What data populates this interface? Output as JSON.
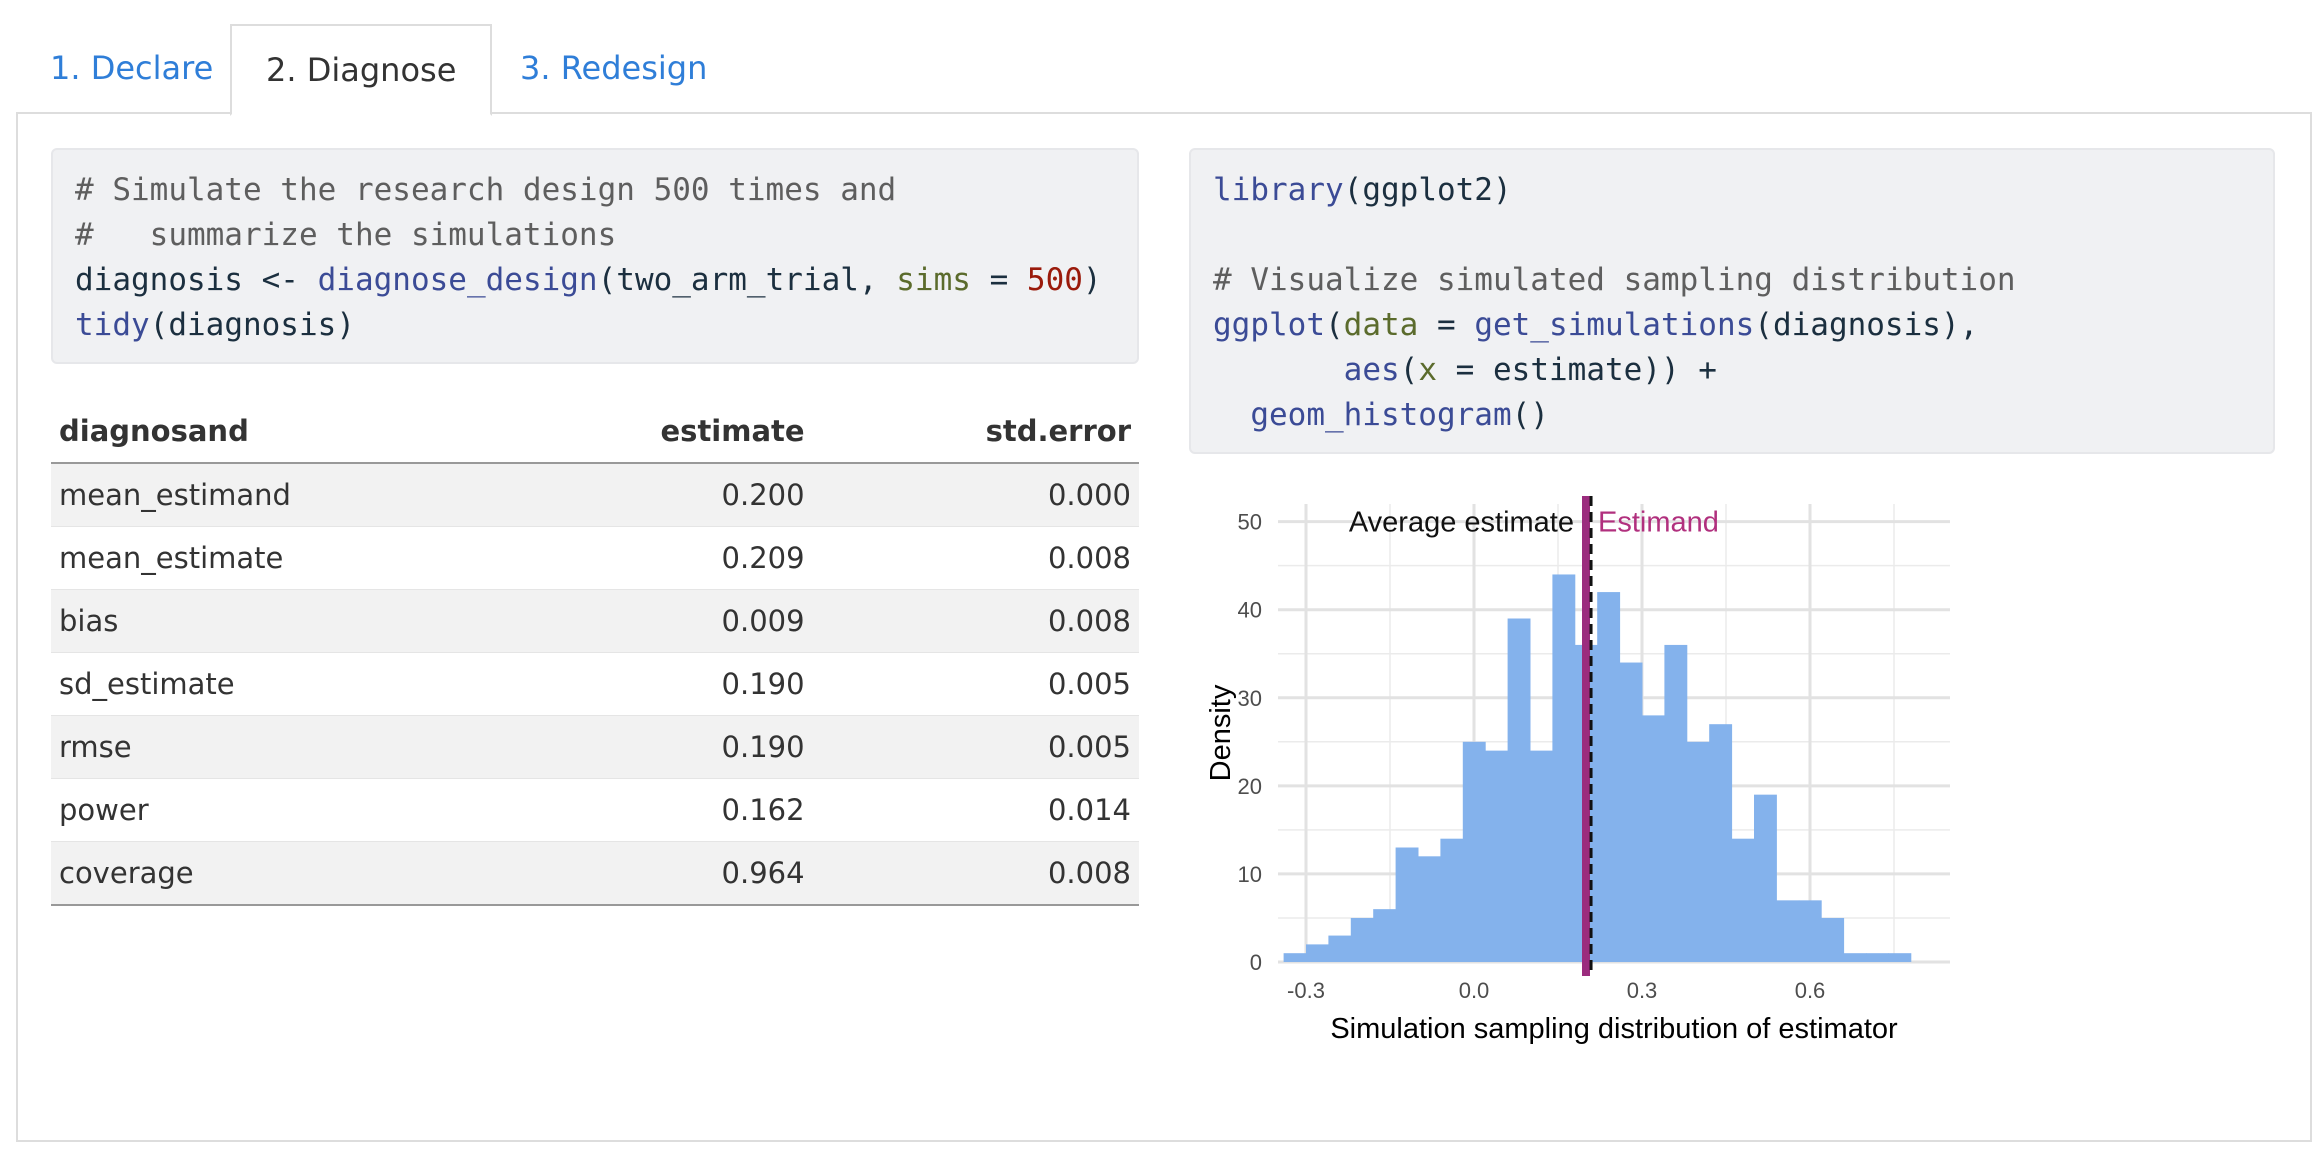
{
  "tabs": [
    {
      "label": "1. Declare",
      "active": false
    },
    {
      "label": "2. Diagnose",
      "active": true
    },
    {
      "label": "3. Redesign",
      "active": false
    }
  ],
  "code_left": {
    "line1": "# Simulate the research design 500 times and",
    "line2": "#   summarize the simulations",
    "line3_var": "diagnosis",
    "line3_op": " <- ",
    "line3_fn": "diagnose_design",
    "line3_obj": "two_arm_trial",
    "line3_arg": "sims",
    "line3_eq": " = ",
    "line3_num": "500",
    "line4_fn": "tidy",
    "line4_arg": "diagnosis"
  },
  "code_right": {
    "line1_fn": "library",
    "line1_arg": "ggplot2",
    "line3": "# Visualize simulated sampling distribution",
    "line4_fn": "ggplot",
    "line4_arg": "data",
    "line4_eq": " = ",
    "line4_fn2": "get_simulations",
    "line4_obj": "diagnosis",
    "line5_fn": "aes",
    "line5_arg": "x",
    "line5_eq": " = ",
    "line5_obj": "estimate",
    "line5_tail": ")) +",
    "line6_fn": "geom_histogram",
    "line6_tail": "()"
  },
  "table": {
    "headers": [
      "diagnosand",
      "estimate",
      "std.error"
    ],
    "rows": [
      [
        "mean_estimand",
        "0.200",
        "0.000"
      ],
      [
        "mean_estimate",
        "0.209",
        "0.008"
      ],
      [
        "bias",
        "0.009",
        "0.008"
      ],
      [
        "sd_estimate",
        "0.190",
        "0.005"
      ],
      [
        "rmse",
        "0.190",
        "0.005"
      ],
      [
        "power",
        "0.162",
        "0.014"
      ],
      [
        "coverage",
        "0.964",
        "0.008"
      ]
    ]
  },
  "chart_data": {
    "type": "bar",
    "xlabel": "Simulation sampling distribution of estimator",
    "ylabel": "Density",
    "xlim": [
      -0.35,
      0.85
    ],
    "ylim": [
      0,
      52
    ],
    "xticks": [
      -0.3,
      0.0,
      0.3,
      0.6
    ],
    "xtick_labels": [
      "-0.3",
      "0.0",
      "0.3",
      "0.6"
    ],
    "yticks": [
      0,
      10,
      20,
      30,
      40,
      50
    ],
    "bin_width": 0.04,
    "bin_left_edges": [
      -0.34,
      -0.3,
      -0.26,
      -0.22,
      -0.18,
      -0.14,
      -0.1,
      -0.06,
      -0.02,
      0.02,
      0.06,
      0.1,
      0.14,
      0.18,
      0.22,
      0.26,
      0.3,
      0.34,
      0.38,
      0.42,
      0.46,
      0.5,
      0.54,
      0.58,
      0.62,
      0.66,
      0.7,
      0.74
    ],
    "values": [
      1,
      2,
      3,
      5,
      6,
      13,
      12,
      14,
      25,
      24,
      39,
      24,
      44,
      36,
      42,
      34,
      28,
      36,
      25,
      27,
      14,
      19,
      7,
      7,
      5,
      1,
      1,
      1
    ],
    "grid": true,
    "annotations": {
      "average_estimate_label": "Average estimate",
      "estimand_label": "Estimand",
      "estimand_value": 0.2,
      "average_estimate_value": 0.209
    },
    "colors": {
      "bars": "#84b2ec",
      "estimand": "#9b2c7e",
      "estimand_text": "#b1307e",
      "average": "#111111",
      "grid": "#ebebeb"
    }
  }
}
